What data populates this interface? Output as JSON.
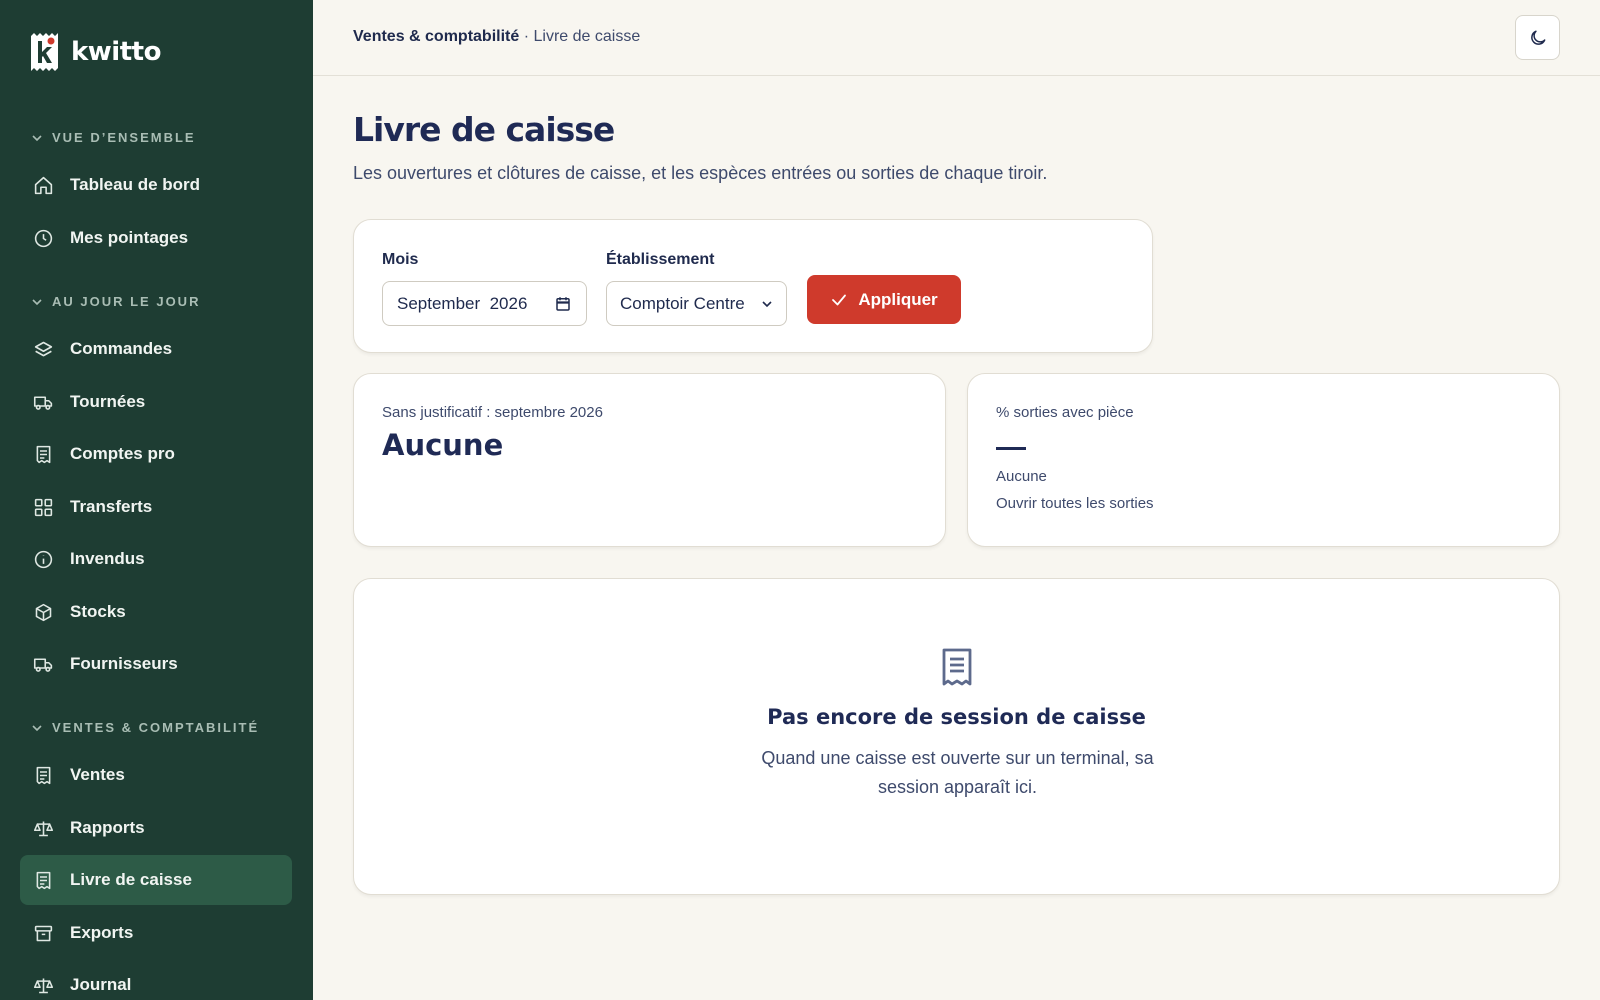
{
  "app": {
    "name": "kwitto"
  },
  "sidebar": {
    "sections": [
      {
        "label": "VUE D’ENSEMBLE"
      },
      {
        "label": "AU JOUR LE JOUR"
      },
      {
        "label": "VENTES & COMPTABILITÉ"
      }
    ],
    "items": [
      {
        "label": "Tableau de bord",
        "icon": "home-icon"
      },
      {
        "label": "Mes pointages",
        "icon": "clock-icon"
      },
      {
        "label": "Commandes",
        "icon": "layers-icon"
      },
      {
        "label": "Tournées",
        "icon": "truck-icon"
      },
      {
        "label": "Comptes pro",
        "icon": "receipt-icon"
      },
      {
        "label": "Transferts",
        "icon": "grid-icon"
      },
      {
        "label": "Invendus",
        "icon": "info-icon"
      },
      {
        "label": "Stocks",
        "icon": "box-icon"
      },
      {
        "label": "Fournisseurs",
        "icon": "truck-icon"
      },
      {
        "label": "Ventes",
        "icon": "receipt-icon"
      },
      {
        "label": "Rapports",
        "icon": "scale-icon"
      },
      {
        "label": "Livre de caisse",
        "icon": "receipt-icon",
        "active": true
      },
      {
        "label": "Exports",
        "icon": "archive-icon"
      },
      {
        "label": "Journal",
        "icon": "scale-icon"
      }
    ]
  },
  "topbar": {
    "breadcrumb_section": "Ventes & comptabilité",
    "breadcrumb_separator": "·",
    "breadcrumb_page": "Livre de caisse",
    "theme_toggle_icon": "moon-icon"
  },
  "page": {
    "title": "Livre de caisse",
    "subtitle": "Les ouvertures et clôtures de caisse, et les espèces entrées ou sorties de chaque tiroir."
  },
  "filters": {
    "month_label": "Mois",
    "month_value": "September  2026",
    "establishment_label": "Établissement",
    "establishment_value": "Comptoir Centre",
    "apply_label": "Appliquer"
  },
  "stats": {
    "unjustified": {
      "label": "Sans justificatif : septembre 2026",
      "value": "Aucune"
    },
    "receipts_pct": {
      "label": "% sorties avec pièce",
      "value": "—",
      "sub": "Aucune",
      "link": "Ouvrir toutes les sorties"
    }
  },
  "empty_state": {
    "icon": "receipt-icon",
    "title": "Pas encore de session de caisse",
    "text": "Quand une caisse est ouverte sur un terminal, sa session apparaît ici."
  },
  "colors": {
    "sidebar_bg": "#1e3d33",
    "sidebar_active": "#2d5b47",
    "accent": "#cf3a2c",
    "page_bg": "#f8f6f0",
    "text_primary": "#1f2a55"
  }
}
